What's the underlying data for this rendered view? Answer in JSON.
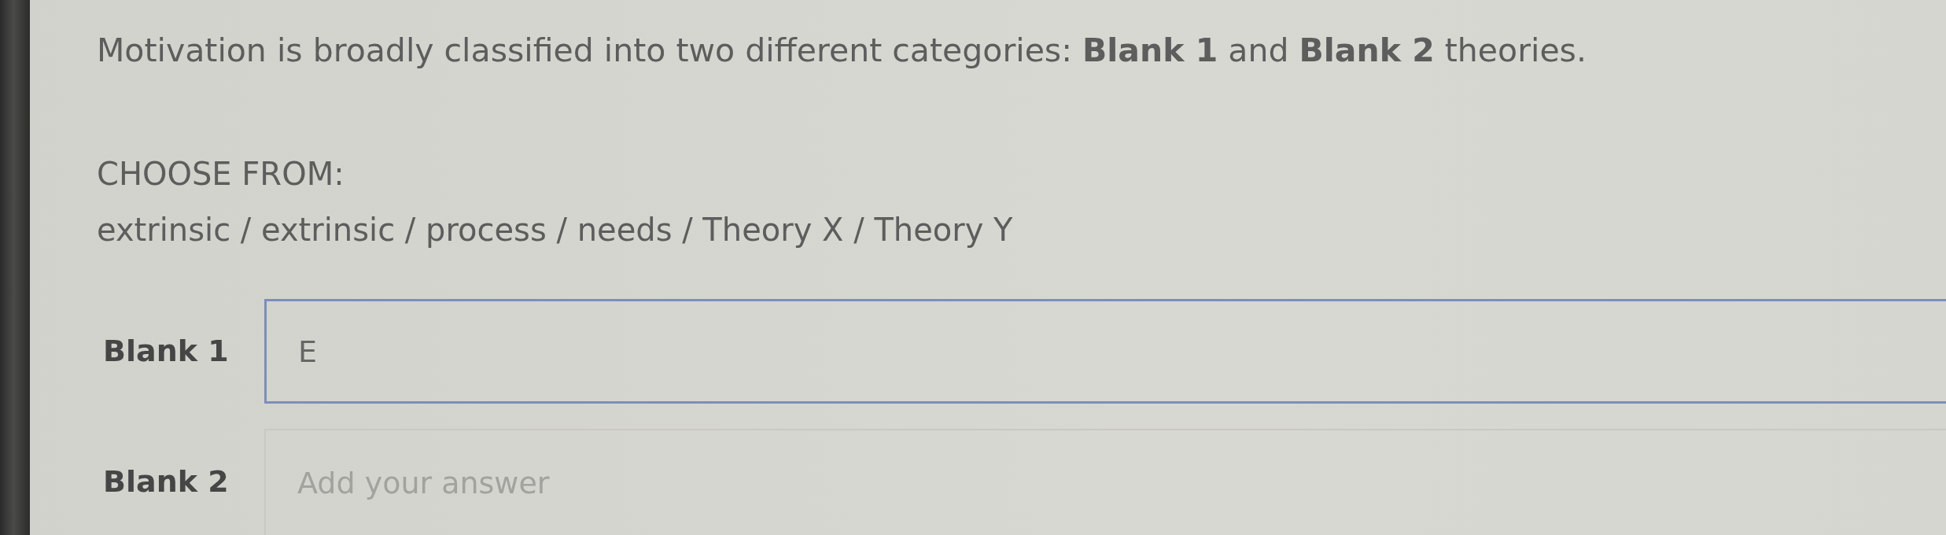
{
  "question": {
    "text": "Motivation is broadly classified into two different categories: **Blank 1** and **Blank 2** theories."
  },
  "choices": {
    "heading": "CHOOSE FROM:",
    "options": "extrinsic / extrinsic / process / needs / Theory X / Theory Y"
  },
  "blanks": [
    {
      "label": "Blank 1",
      "value": "E",
      "focused": true
    },
    {
      "label": "Blank 2",
      "placeholder": "Add your answer",
      "focused": false
    }
  ]
}
